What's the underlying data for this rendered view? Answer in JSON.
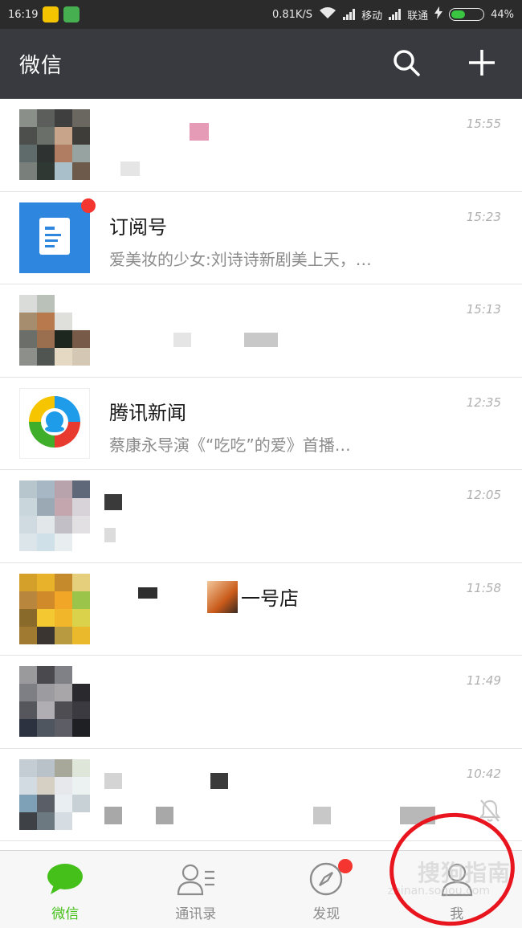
{
  "status_bar": {
    "time": "16:19",
    "net_speed": "0.81K/S",
    "carrier1": "移动",
    "carrier2": "联通",
    "battery_text": "44%",
    "battery_level": 0.44
  },
  "header": {
    "title": "微信",
    "search_icon": "search-icon",
    "add_icon": "plus-icon"
  },
  "chats": [
    {
      "name": "",
      "preview": "",
      "time": "15:55",
      "muted": false,
      "badge": false
    },
    {
      "name": "订阅号",
      "preview": "爱美妆的少女:刘诗诗新剧美上天，…",
      "time": "15:23",
      "muted": false,
      "badge": true
    },
    {
      "name": "",
      "preview": "",
      "time": "15:13",
      "muted": false,
      "badge": false
    },
    {
      "name": "腾讯新闻",
      "preview": "蔡康永导演《“吃吃”的爱》首播…",
      "time": "12:35",
      "muted": false,
      "badge": false
    },
    {
      "name": "",
      "preview": "",
      "time": "12:05",
      "muted": false,
      "badge": false
    },
    {
      "name": "一号店",
      "preview": "",
      "time": "11:58",
      "muted": false,
      "badge": false
    },
    {
      "name": "",
      "preview": "",
      "time": "11:49",
      "muted": false,
      "badge": false
    },
    {
      "name": "",
      "preview": "",
      "time": "10:42",
      "muted": true,
      "badge": false
    }
  ],
  "nav": {
    "items": [
      {
        "label": "微信",
        "icon": "chat-bubble-icon",
        "active": true
      },
      {
        "label": "通讯录",
        "icon": "contacts-icon",
        "active": false
      },
      {
        "label": "发现",
        "icon": "compass-icon",
        "active": false
      },
      {
        "label": "我",
        "icon": "person-icon",
        "active": false
      }
    ]
  },
  "watermark": {
    "text": "搜狗指南",
    "sub": "zhinan.sogou.com"
  },
  "colors": {
    "header_bg": "#393a3f",
    "status_bg": "#2b2b2b",
    "accent_green": "#45c01a",
    "badge_red": "#f43530",
    "annotation_red": "#e8141e"
  }
}
